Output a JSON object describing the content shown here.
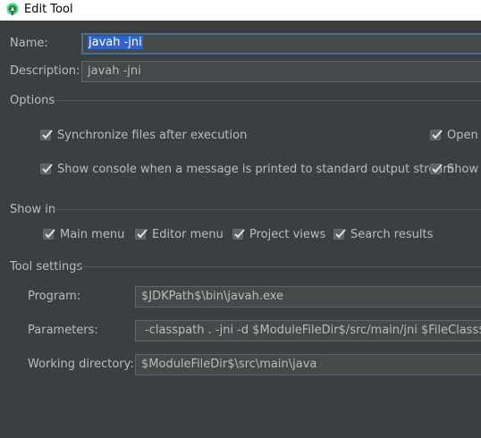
{
  "window": {
    "title": "Edit Tool"
  },
  "fields": {
    "name_label": "Name:",
    "name_value": "javah -jni",
    "description_label": "Description:",
    "description_value": "javah -jni"
  },
  "options": {
    "section_label": "Options",
    "checkboxes": [
      {
        "label": "Synchronize files after execution",
        "checked": true
      },
      {
        "label": "Open c",
        "checked": true
      },
      {
        "label": "Show console when a message is printed to standard output stream",
        "checked": true
      },
      {
        "label": "Show c",
        "checked": true
      }
    ]
  },
  "show_in": {
    "section_label": "Show in",
    "checkboxes": [
      {
        "label": "Main menu",
        "checked": true
      },
      {
        "label": "Editor menu",
        "checked": true
      },
      {
        "label": "Project views",
        "checked": true
      },
      {
        "label": "Search results",
        "checked": true
      }
    ]
  },
  "tool_settings": {
    "section_label": "Tool settings",
    "program_label": "Program:",
    "program_value": "$JDKPath$\\bin\\javah.exe",
    "parameters_label": "Parameters:",
    "parameters_value": "-classpath . -jni -d $ModuleFileDir$/src/main/jni $FileClass$",
    "working_dir_label": "Working directory:",
    "working_dir_value": "$ModuleFileDir$\\src\\main\\java"
  },
  "colors": {
    "background": "#3c3f41",
    "field_background": "#45494a",
    "focus_border": "#466d94",
    "selection": "#2f65ca"
  }
}
